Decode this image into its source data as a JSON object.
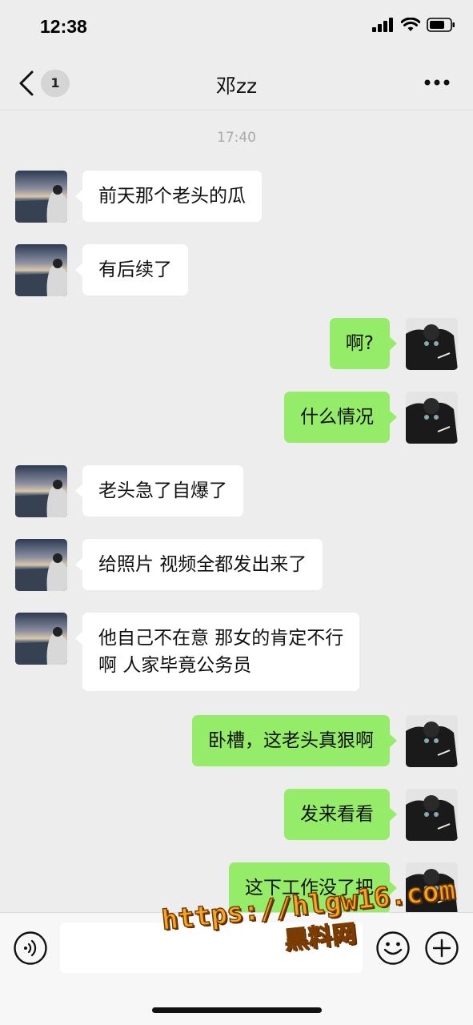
{
  "status_bar": {
    "time": "12:38"
  },
  "header": {
    "unread_count": "1",
    "title": "邓zz"
  },
  "chat": {
    "timestamp": "17:40",
    "messages": [
      {
        "side": "left",
        "text": "前天那个老头的瓜"
      },
      {
        "side": "left",
        "text": "有后续了"
      },
      {
        "side": "right",
        "text": "啊?"
      },
      {
        "side": "right",
        "text": "什么情况"
      },
      {
        "side": "left",
        "text": "老头急了自爆了"
      },
      {
        "side": "left",
        "text": "给照片 视频全都发出来了"
      },
      {
        "side": "left",
        "text": "他自己不在意 那女的肯定不行\n啊 人家毕竟公务员"
      },
      {
        "side": "right",
        "text": "卧槽，这老头真狠啊"
      },
      {
        "side": "right",
        "text": "发来看看"
      },
      {
        "side": "right",
        "text": "这下工作没了把"
      }
    ]
  },
  "input_bar": {
    "value": "",
    "icons": [
      "voice-icon",
      "emoji-icon",
      "plus-icon"
    ]
  },
  "watermark": {
    "line1": "https://hlgw16.com",
    "line2": "黑料网"
  },
  "colors": {
    "background": "#ededed",
    "bubble_self": "#95ec69",
    "bubble_other": "#ffffff",
    "watermark": "#f5a623"
  }
}
